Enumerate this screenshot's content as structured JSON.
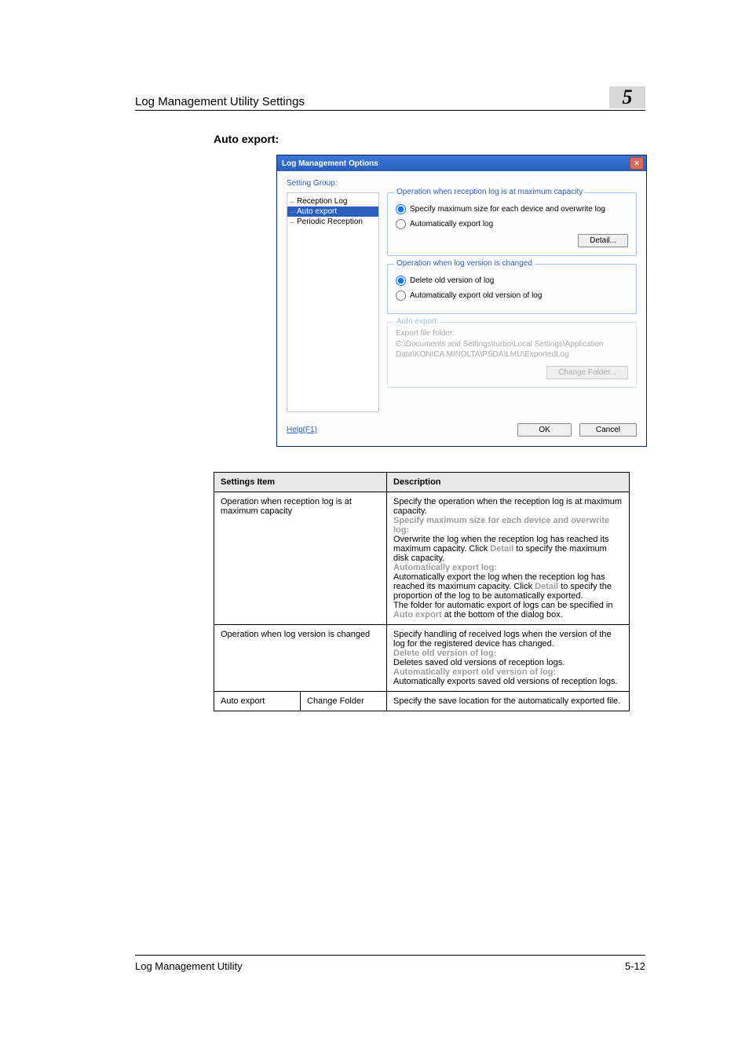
{
  "header": {
    "title": "Log Management Utility Settings",
    "chapter": "5"
  },
  "section_heading": "Auto export:",
  "dialog": {
    "title": "Log Management Options",
    "setting_group_label": "Setting Group:",
    "tree": {
      "i0": "Reception Log",
      "i1": "Auto export",
      "i2": "Periodic Reception"
    },
    "fs1": {
      "legend": "Operation when reception log is at maximum capacity",
      "opt1": "Specify maximum size for each device and overwrite log",
      "opt2": "Automatically export log",
      "detail_btn": "Detail..."
    },
    "fs2": {
      "legend": "Operation when log version is changed",
      "opt1": "Delete old version of log",
      "opt2": "Automatically export old version of log"
    },
    "fs3": {
      "legend": "Auto export",
      "label": "Export file folder:",
      "path": "C:\\Documents and Settings\\turbo\\Local Settings\\Application Data\\KONICA MINOLTA\\PSDA\\LMU\\ExportedLog",
      "change_btn": "Change Folder..."
    },
    "help": "Help(F1)",
    "ok": "OK",
    "cancel": "Cancel"
  },
  "table": {
    "h1": "Settings Item",
    "h2": "Description",
    "r1c1": "Operation when reception log is at maximum capacity",
    "r1c2": {
      "p1": "Specify the operation when the reception log is at maximum capacity.",
      "b1": "Specify maximum size for each device and overwrite log",
      "p2": "Overwrite the log when the reception log has reached its maximum capacity. Click ",
      "l1": "Detail",
      "p3": " to specify the maximum disk capacity.",
      "b2": "Automatically export log",
      "p4": "Automatically export the log when the reception log has reached its maximum capacity. Click ",
      "l2": "Detail",
      "p5": " to specify the proportion of the log to be automatically exported.",
      "p6": "The folder for automatic export of logs can be specified in ",
      "l3": "Auto export",
      "p7": " at the bottom of the dialog box."
    },
    "r2c1": "Operation when log version is changed",
    "r2c2": {
      "p1": "Specify handling of received logs when the version of the log for the registered device has changed.",
      "b1": "Delete old version of log",
      "p2": "Deletes saved old versions of reception logs.",
      "b2": "Automatically export old version of log",
      "p3": "Automatically exports saved old versions of reception logs."
    },
    "r3c1a": "Auto export",
    "r3c1b": "Change Folder",
    "r3c2": "Specify the save location for the automatically exported file."
  },
  "footer": {
    "left": "Log Management Utility",
    "right": "5-12"
  }
}
